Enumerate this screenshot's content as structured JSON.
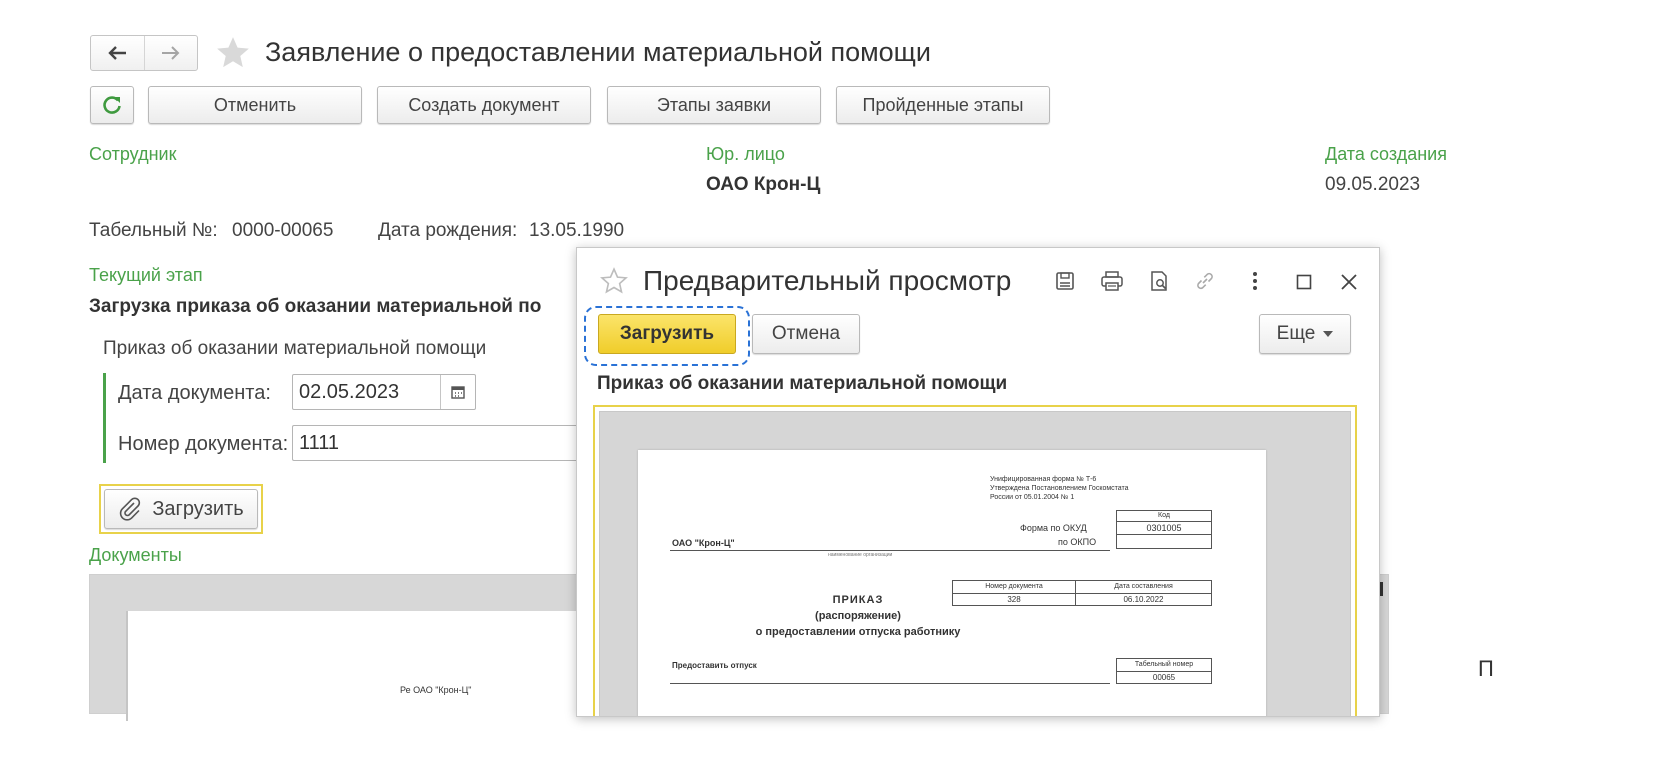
{
  "header": {
    "title": "Заявление о предоставлении материальной помощи"
  },
  "toolbar": {
    "cancel_label": "Отменить",
    "create_doc_label": "Создать документ",
    "stages_label": "Этапы заявки",
    "passed_stages_label": "Пройденные этапы"
  },
  "form": {
    "employee_label": "Сотрудник",
    "legal_entity_label": "Юр. лицо",
    "legal_entity_value": "ОАО Крон-Ц",
    "creation_date_label": "Дата создания",
    "creation_date_value": "09.05.2023",
    "tab_number_label": "Табельный №:",
    "tab_number_value": "0000-00065",
    "birth_date_label": "Дата рождения:",
    "birth_date_value": "13.05.1990",
    "current_stage_label": "Текущий этап",
    "current_stage_value": "Загрузка приказа об оказании материальной по",
    "order_group_title": "Приказ об оказании материальной помощи",
    "doc_date_label": "Дата документа:",
    "doc_date_value": "02.05.2023",
    "doc_number_label": "Номер документа:",
    "doc_number_value": "1111",
    "upload_label": "Загрузить",
    "documents_label": "Документы",
    "bg_doc_text": "Ре ОАО \"Крон-Ц\""
  },
  "preview": {
    "title": "Предварительный просмотр",
    "upload_label": "Загрузить",
    "cancel_label": "Отмена",
    "more_label": "Еще",
    "doc_title": "Приказ об оказании материальной помощи",
    "document": {
      "form_note_1": "Унифицированная форма № Т-6",
      "form_note_2": "Утверждена Постановлением Госкомстата",
      "form_note_3": "России от 05.01.2004 № 1",
      "code_header": "Код",
      "okud_label": "Форма по ОКУД",
      "okud_value": "0301005",
      "okpo_label": "по ОКПО",
      "org_name": "ОАО \"Крон-Ц\"",
      "org_caption": "наименование организации",
      "doc_number_header": "Номер документа",
      "doc_date_header": "Дата составления",
      "doc_number_value": "328",
      "doc_date_value": "06.10.2022",
      "order_title": "ПРИКАЗ",
      "order_subtitle": "(распоряжение)",
      "order_subject": "о предоставлении отпуска работнику",
      "grant_leave": "Предоставить отпуск",
      "tab_number_header": "Табельный номер",
      "tab_number_value": "00065"
    }
  },
  "edge": {
    "right_glyph": "П"
  },
  "colors": {
    "green_label": "#4aa24a",
    "yellow_button": "#f5d63a",
    "focus_border": "#2a72d6",
    "highlight_border": "#e8d24a"
  }
}
